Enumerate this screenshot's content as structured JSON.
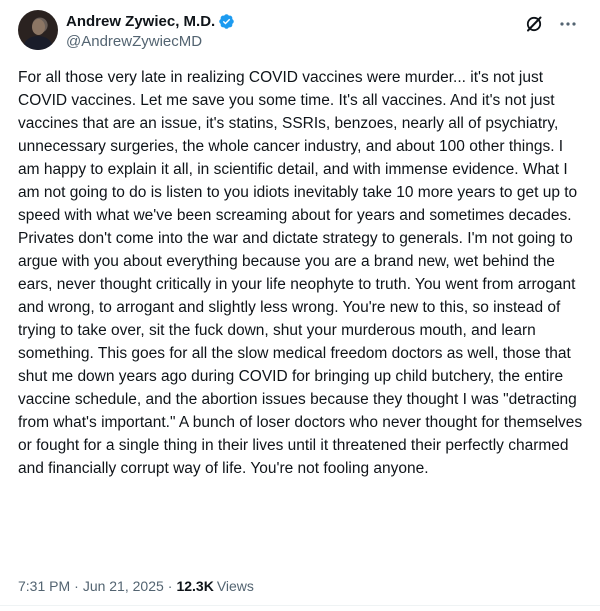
{
  "author": {
    "display_name": "Andrew Zywiec, M.D.",
    "handle": "@AndrewZywiecMD",
    "verified": true
  },
  "icons": {
    "verified": "verified-badge-icon",
    "grok": "grok-icon",
    "more": "more-icon",
    "avatar": "avatar"
  },
  "colors": {
    "verified_blue": "#1d9bf0",
    "secondary_text": "#536471",
    "primary_text": "#0f1419"
  },
  "tweet": {
    "text": "For all those very late in realizing COVID vaccines were murder... it's not just COVID vaccines. Let me save you some time. It's all vaccines. And it's not just vaccines that are an issue, it's statins, SSRIs, benzoes, nearly all of psychiatry, unnecessary surgeries, the whole cancer industry, and about 100 other things. I am happy to explain it all, in scientific detail, and with immense evidence. What I am not going to do is listen to you idiots inevitably take 10 more years to get up to speed with what we've been screaming about for years and sometimes decades. Privates don't come into the war and dictate strategy to generals. I'm not going to argue with you about everything because you are a brand new, wet behind the ears, never thought critically in your life neophyte to truth. You went from arrogant and wrong, to arrogant and slightly less wrong. You're new to this, so instead of trying to take over, sit the fuck down, shut your murderous mouth, and learn something. This goes for all the slow medical freedom doctors as well, those that shut me down years ago during COVID for bringing up child butchery, the entire vaccine schedule, and the abortion issues because they thought I was \"detracting from what's important.\" A bunch of loser doctors who never thought for themselves or fought for a single thing in their lives until it threatened their perfectly charmed and financially corrupt way of life. You're not fooling anyone.",
    "time": "7:31 PM",
    "separator": "·",
    "date": "Jun 21, 2025",
    "views_count": "12.3K",
    "views_label": "Views"
  }
}
